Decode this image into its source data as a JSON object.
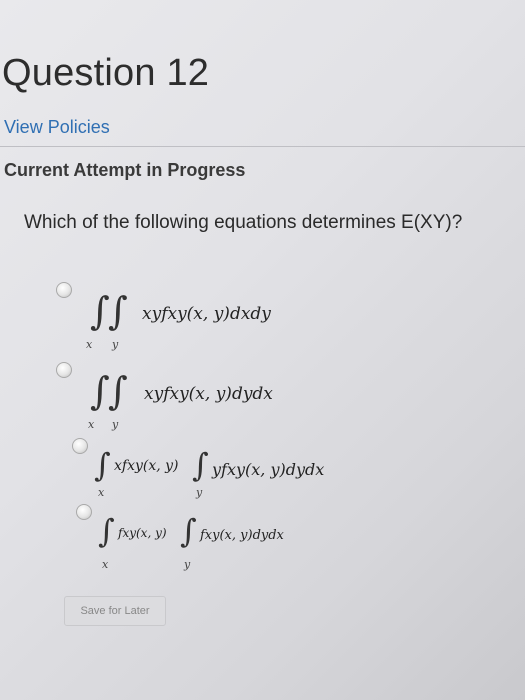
{
  "question": {
    "title": "Question 12",
    "view_policies": "View Policies",
    "attempt_status": "Current Attempt in Progress",
    "prompt": "Which of the following equations determines E(XY)?"
  },
  "options": [
    {
      "integral_1": "∫",
      "integral_2": "∫",
      "sub_1": "x",
      "sub_2": "y",
      "expr": "xyfxy(x, y)dxdy"
    },
    {
      "integral_1": "∫",
      "integral_2": "∫",
      "sub_1": "x",
      "sub_2": "y",
      "expr": "xyfxy(x, y)dydx"
    },
    {
      "integral_1": "∫",
      "sub_1": "x",
      "expr_1": "xfxy(x, y)",
      "integral_2": "∫",
      "sub_2": "y",
      "expr_2": "yfxy(x, y)dydx"
    },
    {
      "integral_1": "∫",
      "sub_1": "x",
      "expr_1": "fxy(x, y)",
      "integral_2": "∫",
      "sub_2": "y",
      "expr_2": "fxy(x, y)dydx"
    }
  ],
  "save_button": "Save for Later"
}
